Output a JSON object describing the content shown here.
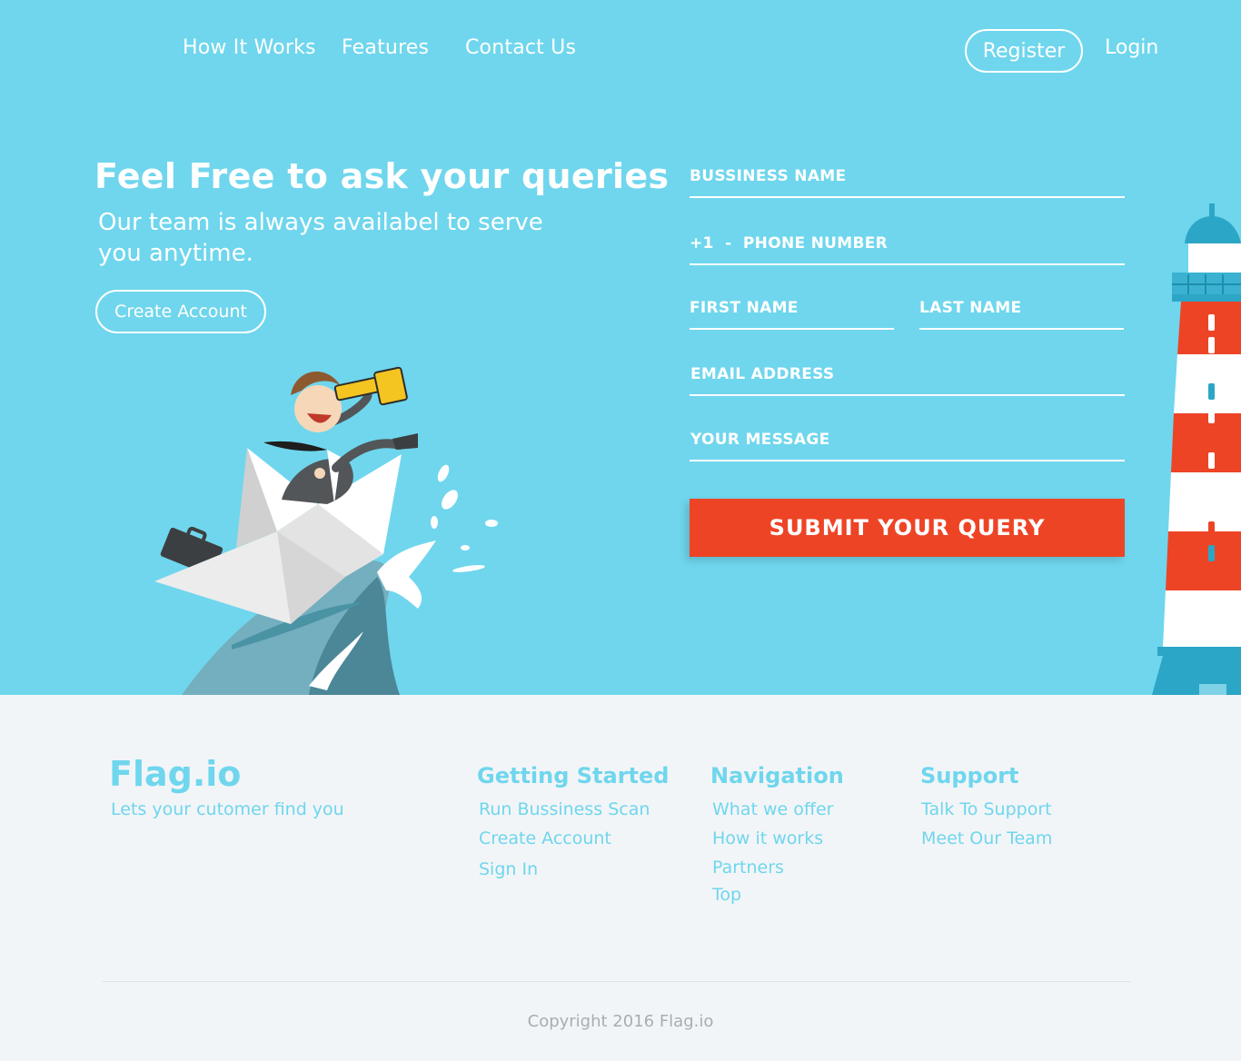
{
  "nav": {
    "links": [
      "How It Works",
      "Features",
      "Contact Us"
    ],
    "register_label": "Register",
    "login_label": "Login"
  },
  "hero": {
    "title": "Feel Free to ask your queries",
    "subtitle": "Our team is always availabel to serve you anytime.",
    "create_account_label": "Create Account"
  },
  "form": {
    "business_name_placeholder": "BUSSINESS NAME",
    "phone_placeholder": "+1  -  PHONE NUMBER",
    "first_name_placeholder": "FIRST NAME",
    "last_name_placeholder": "LAST NAME",
    "email_placeholder": "EMAIL ADDRESS",
    "message_placeholder": "YOUR MESSAGE",
    "submit_label": "SUBMIT YOUR QUERY"
  },
  "footer": {
    "brand": "Flag.io",
    "tagline": "Lets your cutomer find you",
    "columns": [
      {
        "heading": "Getting Started",
        "links": [
          "Run Bussiness Scan",
          "Create Account",
          "Sign In"
        ]
      },
      {
        "heading": "Navigation",
        "links": [
          "What we offer",
          "How it works",
          "Partners",
          "Top"
        ]
      },
      {
        "heading": "Support",
        "links": [
          "Talk To Support",
          "Meet Our Team"
        ]
      }
    ],
    "copyright": "Copyright 2016 Flag.io"
  },
  "colors": {
    "hero_bg": "#6fd6ed",
    "accent_red": "#ee4426",
    "footer_bg": "#f2f5f8",
    "footer_text": "#6fd6ed",
    "muted": "#a7adb2"
  },
  "icons": {
    "illustration": "businessman-on-paper-boat-illustration",
    "lighthouse": "lighthouse-illustration"
  }
}
